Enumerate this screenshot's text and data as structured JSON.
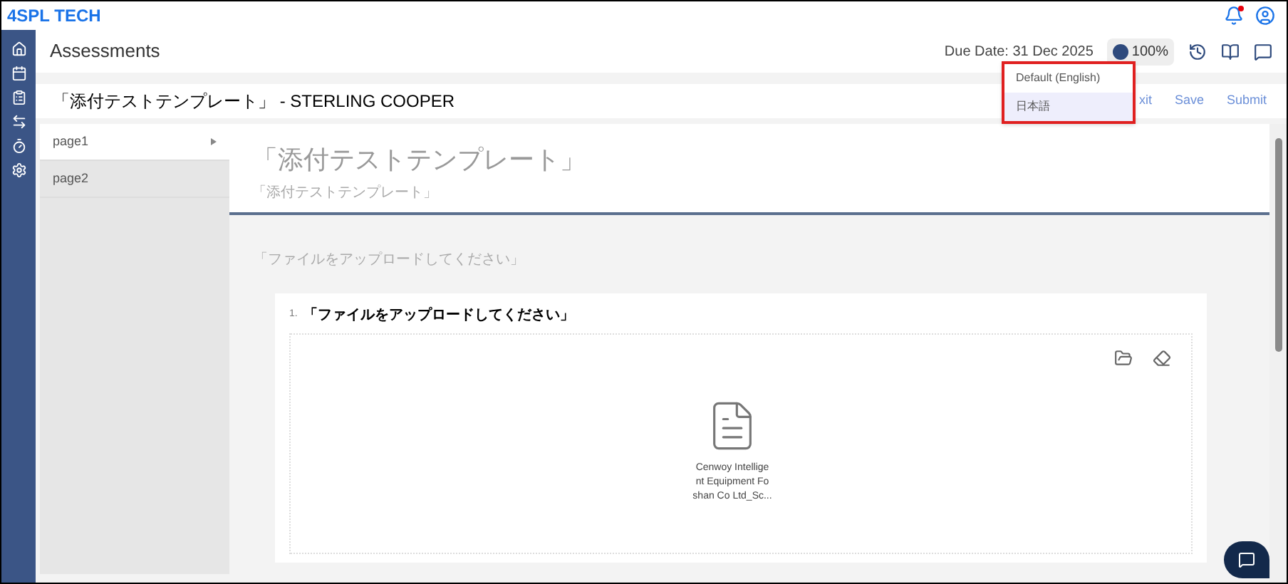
{
  "brand": "4SPL TECH",
  "header": {
    "title": "Assessments",
    "due_date": "Due Date: 31 Dec 2025",
    "progress": "100%"
  },
  "language_menu": {
    "items": [
      {
        "label": "Default (English)",
        "selected": false
      },
      {
        "label": "日本語",
        "selected": true
      }
    ]
  },
  "form": {
    "title": "「添付テストテンプレート」 - STERLING COOPER",
    "actions": [
      "xit",
      "Save",
      "Submit"
    ]
  },
  "pages": [
    {
      "label": "page1",
      "selected": true
    },
    {
      "label": "page2",
      "selected": false
    }
  ],
  "survey": {
    "title": "「添付テストテンプレート」",
    "subtitle": "「添付テストテンプレート」",
    "section": "「ファイルをアップロードしてください」",
    "question": {
      "number": "1.",
      "text": "「ファイルをアップロードしてください」",
      "file_name": "Cenwoy Intellige\nnt Equipment Fo\nshan Co Ltd_Sc..."
    }
  }
}
